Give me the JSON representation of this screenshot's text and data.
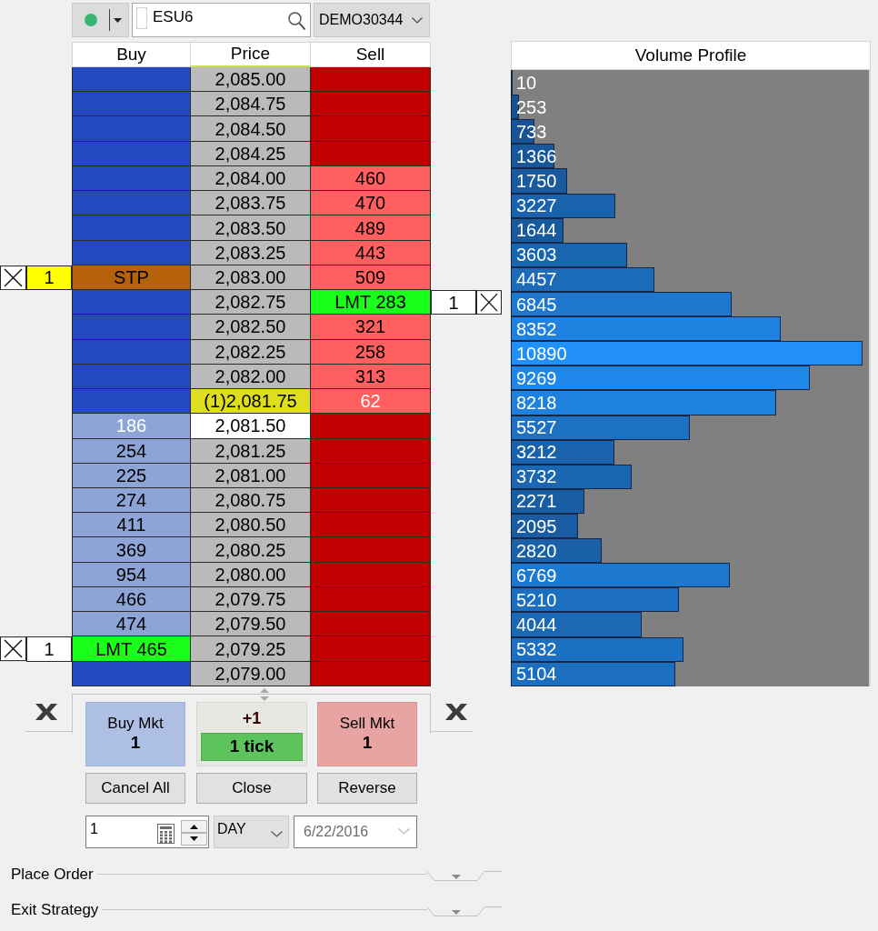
{
  "toolbar": {
    "connected": true,
    "symbol": "ESU6",
    "account": "DEMO30344"
  },
  "ladder": {
    "columns": [
      "Buy",
      "Price",
      "Sell"
    ],
    "rows": [
      {
        "price": {
          "text": "2,085.00",
          "kind": "normal"
        },
        "buy": {
          "kind": "empty"
        },
        "sell": {
          "kind": "empty"
        }
      },
      {
        "price": {
          "text": "2,084.75",
          "kind": "normal"
        },
        "buy": {
          "kind": "empty"
        },
        "sell": {
          "kind": "empty"
        }
      },
      {
        "price": {
          "text": "2,084.50",
          "kind": "normal"
        },
        "buy": {
          "kind": "empty"
        },
        "sell": {
          "kind": "empty"
        }
      },
      {
        "price": {
          "text": "2,084.25",
          "kind": "normal"
        },
        "buy": {
          "kind": "empty"
        },
        "sell": {
          "kind": "empty"
        }
      },
      {
        "price": {
          "text": "2,084.00",
          "kind": "normal"
        },
        "buy": {
          "kind": "empty"
        },
        "sell": {
          "kind": "depth",
          "text": "460"
        }
      },
      {
        "price": {
          "text": "2,083.75",
          "kind": "normal"
        },
        "buy": {
          "kind": "empty"
        },
        "sell": {
          "kind": "depth",
          "text": "470"
        }
      },
      {
        "price": {
          "text": "2,083.50",
          "kind": "normal"
        },
        "buy": {
          "kind": "empty"
        },
        "sell": {
          "kind": "depth",
          "text": "489"
        }
      },
      {
        "price": {
          "text": "2,083.25",
          "kind": "normal"
        },
        "buy": {
          "kind": "empty"
        },
        "sell": {
          "kind": "depth",
          "text": "443"
        }
      },
      {
        "price": {
          "text": "2,083.00",
          "kind": "normal"
        },
        "buy": {
          "kind": "stop",
          "text": "STP"
        },
        "sell": {
          "kind": "depth",
          "text": "509"
        },
        "buy_order": {
          "quantity": "1",
          "kind": "stop"
        }
      },
      {
        "price": {
          "text": "2,082.75",
          "kind": "normal"
        },
        "buy": {
          "kind": "empty"
        },
        "sell": {
          "kind": "limit",
          "text": "LMT 283"
        },
        "sell_order": {
          "quantity": "1",
          "kind": "limit"
        }
      },
      {
        "price": {
          "text": "2,082.50",
          "kind": "normal"
        },
        "buy": {
          "kind": "empty"
        },
        "sell": {
          "kind": "depth",
          "text": "321"
        }
      },
      {
        "price": {
          "text": "2,082.25",
          "kind": "normal"
        },
        "buy": {
          "kind": "empty"
        },
        "sell": {
          "kind": "depth",
          "text": "258"
        }
      },
      {
        "price": {
          "text": "2,082.00",
          "kind": "normal"
        },
        "buy": {
          "kind": "empty"
        },
        "sell": {
          "kind": "depth",
          "text": "313"
        }
      },
      {
        "price": {
          "text": "(1)2,081.75",
          "kind": "position"
        },
        "buy": {
          "kind": "empty"
        },
        "sell": {
          "kind": "inside",
          "text": "62"
        }
      },
      {
        "price": {
          "text": "2,081.50",
          "kind": "last"
        },
        "buy": {
          "kind": "inside",
          "text": "186"
        },
        "sell": {
          "kind": "empty"
        }
      },
      {
        "price": {
          "text": "2,081.25",
          "kind": "normal"
        },
        "buy": {
          "kind": "depth",
          "text": "254"
        },
        "sell": {
          "kind": "empty"
        }
      },
      {
        "price": {
          "text": "2,081.00",
          "kind": "normal"
        },
        "buy": {
          "kind": "depth",
          "text": "225"
        },
        "sell": {
          "kind": "empty"
        }
      },
      {
        "price": {
          "text": "2,080.75",
          "kind": "normal"
        },
        "buy": {
          "kind": "depth",
          "text": "274"
        },
        "sell": {
          "kind": "empty"
        }
      },
      {
        "price": {
          "text": "2,080.50",
          "kind": "normal"
        },
        "buy": {
          "kind": "depth",
          "text": "411"
        },
        "sell": {
          "kind": "empty"
        }
      },
      {
        "price": {
          "text": "2,080.25",
          "kind": "normal"
        },
        "buy": {
          "kind": "depth",
          "text": "369"
        },
        "sell": {
          "kind": "empty"
        }
      },
      {
        "price": {
          "text": "2,080.00",
          "kind": "normal"
        },
        "buy": {
          "kind": "depth",
          "text": "954"
        },
        "sell": {
          "kind": "empty"
        }
      },
      {
        "price": {
          "text": "2,079.75",
          "kind": "normal"
        },
        "buy": {
          "kind": "depth",
          "text": "466"
        },
        "sell": {
          "kind": "empty"
        }
      },
      {
        "price": {
          "text": "2,079.50",
          "kind": "normal"
        },
        "buy": {
          "kind": "depth",
          "text": "474"
        },
        "sell": {
          "kind": "empty"
        }
      },
      {
        "price": {
          "text": "2,079.25",
          "kind": "normal"
        },
        "buy": {
          "kind": "limit",
          "text": "LMT 465"
        },
        "sell": {
          "kind": "empty"
        },
        "buy_order": {
          "quantity": "1",
          "kind": "limit"
        }
      },
      {
        "price": {
          "text": "2,079.00",
          "kind": "normal"
        },
        "buy": {
          "kind": "empty"
        },
        "sell": {
          "kind": "empty"
        }
      }
    ]
  },
  "market_buttons": [
    {
      "kind": "buy",
      "label": "Buy Mkt",
      "value": "1"
    },
    {
      "kind": "offset",
      "label": "+1",
      "value": "1 tick"
    },
    {
      "kind": "sell",
      "label": "Sell Mkt",
      "value": "1"
    }
  ],
  "action_buttons": [
    "Cancel All",
    "Close",
    "Reverse"
  ],
  "order_entry": {
    "quantity": "1",
    "duration": "DAY",
    "expiry": {
      "text": "6/22/2016",
      "disabled": true
    }
  },
  "sections": [
    {
      "label": "Place Order",
      "expanded": false
    },
    {
      "label": "Exit Strategy",
      "expanded": false
    }
  ],
  "volume_profile": {
    "title": "Volume Profile",
    "rows": [
      {
        "volume": "10",
        "level": 0.001
      },
      {
        "volume": "253",
        "level": 0.023
      },
      {
        "volume": "733",
        "level": 0.066
      },
      {
        "volume": "1366",
        "level": 0.123
      },
      {
        "volume": "1750",
        "level": 0.158
      },
      {
        "volume": "3227",
        "level": 0.291
      },
      {
        "volume": "1644",
        "level": 0.148
      },
      {
        "volume": "3603",
        "level": 0.325
      },
      {
        "volume": "4457",
        "level": 0.402
      },
      {
        "volume": "6845",
        "level": 0.617
      },
      {
        "volume": "8352",
        "level": 0.753
      },
      {
        "volume": "10890",
        "level": 0.982
      },
      {
        "volume": "9269",
        "level": 0.836
      },
      {
        "volume": "8218",
        "level": 0.741
      },
      {
        "volume": "5527",
        "level": 0.499
      },
      {
        "volume": "3212",
        "level": 0.29
      },
      {
        "volume": "3732",
        "level": 0.337
      },
      {
        "volume": "2271",
        "level": 0.205
      },
      {
        "volume": "2095",
        "level": 0.189
      },
      {
        "volume": "2820",
        "level": 0.254
      },
      {
        "volume": "6769",
        "level": 0.611
      },
      {
        "volume": "5210",
        "level": 0.47
      },
      {
        "volume": "4044",
        "level": 0.365
      },
      {
        "volume": "5332",
        "level": 0.481
      },
      {
        "volume": "5104",
        "level": 0.46
      }
    ]
  }
}
